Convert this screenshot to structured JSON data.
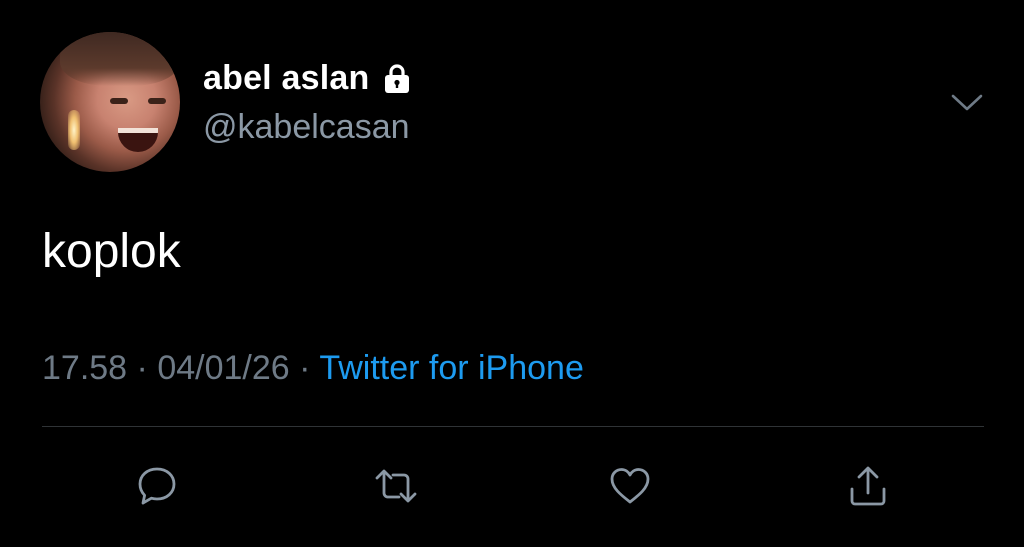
{
  "tweet": {
    "display_name": "abel aslan",
    "handle": "@kabelcasan",
    "text": "koplok",
    "time": "17.58",
    "date": "04/01/26",
    "separator": "·",
    "source": "Twitter for iPhone"
  },
  "icons": {
    "protected": "lock-icon",
    "more": "chevron-down-icon",
    "reply": "reply-icon",
    "retweet": "retweet-icon",
    "like": "heart-icon",
    "share": "share-icon"
  },
  "colors": {
    "background": "#000000",
    "primary_text": "#ffffff",
    "secondary_text": "#8b98a5",
    "meta_text": "#6e7a86",
    "link": "#1d9bf0",
    "icon": "#8b98a5",
    "divider": "#2f3336"
  }
}
